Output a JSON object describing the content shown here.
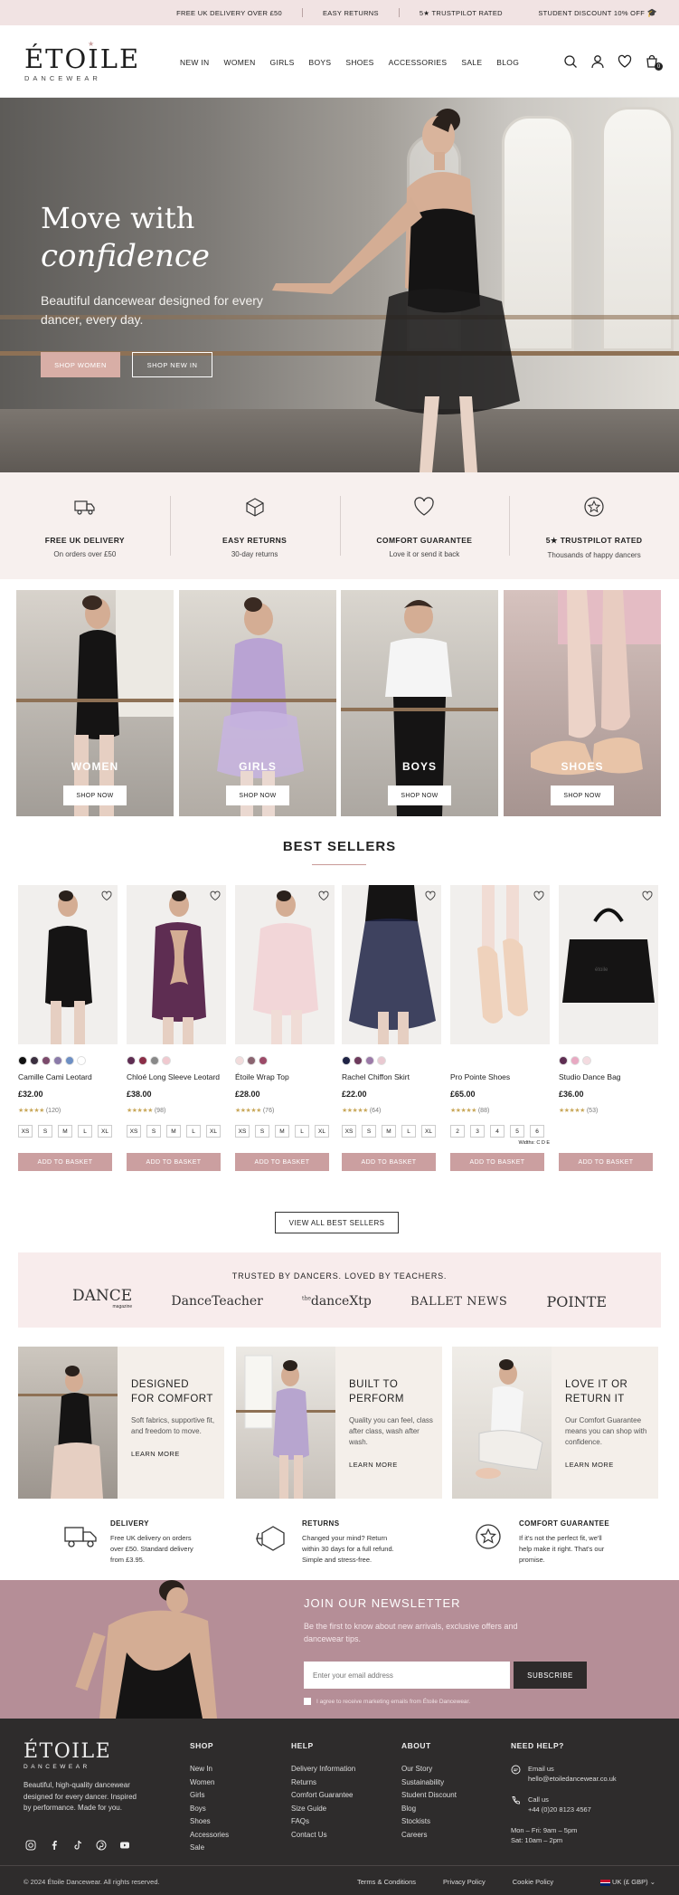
{
  "topbar": {
    "items": [
      "FREE UK DELIVERY OVER £50",
      "EASY RETURNS",
      "5★ TRUSTPILOT RATED"
    ],
    "student": "STUDENT DISCOUNT 10% OFF"
  },
  "brand": {
    "name": "ÉTOILE",
    "sub": "DANCEWEAR"
  },
  "nav": [
    "NEW IN",
    "WOMEN",
    "GIRLS",
    "BOYS",
    "SHOES",
    "ACCESSORIES",
    "SALE",
    "BLOG"
  ],
  "header_icons": [
    "search-icon",
    "account-icon",
    "heart-icon",
    "basket-icon"
  ],
  "basket_count": "0",
  "hero": {
    "title_line1": "Move with",
    "title_line2": "confidence",
    "subtitle": "Beautiful dancewear designed for every dancer, every day.",
    "btn_primary": "SHOP WOMEN",
    "btn_secondary": "SHOP NEW IN"
  },
  "features": [
    {
      "icon": "truck-icon",
      "title": "FREE UK DELIVERY",
      "desc": "On orders over £50"
    },
    {
      "icon": "box-return-icon",
      "title": "EASY RETURNS",
      "desc": "30-day returns"
    },
    {
      "icon": "heart-icon",
      "title": "COMFORT GUARANTEE",
      "desc": "Love it or send it back"
    },
    {
      "icon": "star-badge-icon",
      "title": "5★ TRUSTPILOT RATED",
      "desc": "Thousands of happy dancers"
    }
  ],
  "categories": [
    {
      "label": "WOMEN",
      "btn": "SHOP NOW"
    },
    {
      "label": "GIRLS",
      "btn": "SHOP NOW"
    },
    {
      "label": "BOYS",
      "btn": "SHOP NOW"
    },
    {
      "label": "SHOES",
      "btn": "SHOP NOW"
    }
  ],
  "best_sellers": {
    "title": "BEST SELLERS",
    "add_label": "ADD TO BASKET",
    "view_all": "VIEW ALL BEST SELLERS",
    "products": [
      {
        "name": "Camille Cami Leotard",
        "price": "£32.00",
        "reviews": "(120)",
        "stars": "★★★★★",
        "swatches": [
          "#111111",
          "#3a2f3f",
          "#7b4a6b",
          "#8a7aa8",
          "#6d8fc4",
          "#ffffff"
        ],
        "sizes": [
          "XS",
          "S",
          "M",
          "L",
          "XL"
        ],
        "extra": ""
      },
      {
        "name": "Chloé Long Sleeve Leotard",
        "price": "£38.00",
        "reviews": "(98)",
        "stars": "★★★★★",
        "swatches": [
          "#5e2d52",
          "#8a2d47",
          "#888888",
          "#f0c9cf"
        ],
        "sizes": [
          "XS",
          "S",
          "M",
          "L",
          "XL"
        ],
        "extra": ""
      },
      {
        "name": "Étoile Wrap Top",
        "price": "£28.00",
        "reviews": "(76)",
        "stars": "★★★★★",
        "swatches": [
          "#f2dcdc",
          "#8a6470",
          "#9c4a68"
        ],
        "sizes": [
          "XS",
          "S",
          "M",
          "L",
          "XL"
        ],
        "extra": ""
      },
      {
        "name": "Rachel Chiffon Skirt",
        "price": "£22.00",
        "reviews": "(64)",
        "stars": "★★★★★",
        "swatches": [
          "#1e2345",
          "#6d3a5c",
          "#9b7aa8",
          "#e9c9d1"
        ],
        "sizes": [
          "XS",
          "S",
          "M",
          "L",
          "XL"
        ],
        "extra": ""
      },
      {
        "name": "Pro Pointe Shoes",
        "price": "£65.00",
        "reviews": "(88)",
        "stars": "★★★★★",
        "swatches": [],
        "sizes": [
          "2",
          "3",
          "4",
          "5",
          "6"
        ],
        "extra": "Widths: C D E"
      },
      {
        "name": "Studio Dance Bag",
        "price": "£36.00",
        "reviews": "(53)",
        "stars": "★★★★★",
        "swatches": [
          "#5e2d52",
          "#e8a9c2",
          "#f4dbe0"
        ],
        "sizes": [],
        "extra": ""
      }
    ]
  },
  "press": {
    "title": "TRUSTED BY DANCERS. LOVED BY TEACHERS.",
    "logos": [
      "DANCE",
      "DanceTeacher",
      "danceXtp",
      "BALLET NEWS",
      "POINTE"
    ],
    "dance_sub": "magazine",
    "xtp_small": "the"
  },
  "stories": [
    {
      "title_a": "DESIGNED",
      "title_b": "FOR COMFORT",
      "text": "Soft fabrics, supportive fit, and freedom to move.",
      "link": "LEARN MORE"
    },
    {
      "title_a": "BUILT TO",
      "title_b": "PERFORM",
      "text": "Quality you can feel, class after class, wash after wash.",
      "link": "LEARN MORE"
    },
    {
      "title_a": "LOVE IT OR",
      "title_b": "RETURN IT",
      "text": "Our Comfort Guarantee means you can shop with confidence.",
      "link": "LEARN MORE"
    }
  ],
  "info": [
    {
      "icon": "truck-icon",
      "title": "DELIVERY",
      "text": "Free UK delivery on orders over £50. Standard delivery from £3.95."
    },
    {
      "icon": "return-icon",
      "title": "RETURNS",
      "text": "Changed your mind? Return within 30 days for a full refund. Simple and stress-free."
    },
    {
      "icon": "star-badge-icon",
      "title": "COMFORT GUARANTEE",
      "text": "If it's not the perfect fit, we'll help make it right. That's our promise."
    }
  ],
  "newsletter": {
    "title": "JOIN OUR NEWSLETTER",
    "text": "Be the first to know about new arrivals, exclusive offers and dancewear tips.",
    "placeholder": "Enter your email address",
    "btn": "SUBSCRIBE",
    "consent": "I agree to receive marketing emails from Étoile Dancewear."
  },
  "footer": {
    "tagline": "Beautiful, high-quality dancewear designed for every dancer. Inspired by performance. Made for you.",
    "social": [
      "instagram-icon",
      "facebook-icon",
      "tiktok-icon",
      "pinterest-icon",
      "youtube-icon"
    ],
    "shop": {
      "title": "SHOP",
      "items": [
        "New In",
        "Women",
        "Girls",
        "Boys",
        "Shoes",
        "Accessories",
        "Sale"
      ]
    },
    "help": {
      "title": "HELP",
      "items": [
        "Delivery Information",
        "Returns",
        "Comfort Guarantee",
        "Size Guide",
        "FAQs",
        "Contact Us"
      ]
    },
    "about": {
      "title": "ABOUT",
      "items": [
        "Our Story",
        "Sustainability",
        "Student Discount",
        "Blog",
        "Stockists",
        "Careers"
      ]
    },
    "need_help": {
      "title": "NEED HELP?",
      "email_label": "Email us",
      "email": "hello@etoiledancewear.co.uk",
      "call_label": "Call us",
      "phone": "+44 (0)20 8123 4567",
      "hours1": "Mon – Fri: 9am – 5pm",
      "hours2": "Sat: 10am – 2pm"
    },
    "copyright": "© 2024 Étoile Dancewear. All rights reserved.",
    "links": [
      "Terms & Conditions",
      "Privacy Policy",
      "Cookie Policy"
    ],
    "currency": "UK (£ GBP)"
  },
  "colors": {
    "accent": "#cb9fa0",
    "topbar": "#f1e3e3",
    "newsletter": "#b58e97",
    "footer": "#2e2c2c"
  }
}
